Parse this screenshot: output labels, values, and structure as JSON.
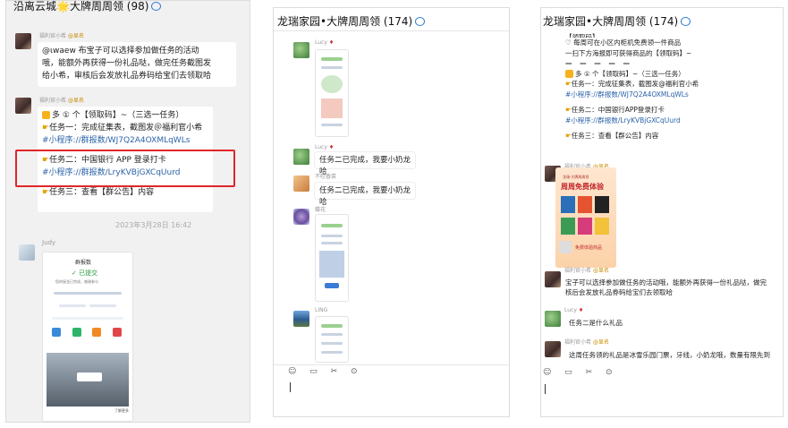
{
  "panel1": {
    "title": "沿离云城🌟大牌周周领 (98)",
    "msg1": {
      "sender": "福利官小希",
      "badge": "@显名",
      "lines": [
        "@ιwaew 布宝子可以选择参加做任务的活动",
        "哦，能额外再获得一份礼品哒，做完任务截图发",
        "给小希，审核后会发放礼品券码给宝们去领取哈"
      ]
    },
    "msg2": {
      "sender": "福利官小希",
      "badge": "@显名",
      "line1": "多 ① 个【领取码】~（三选一任务）",
      "line2": "任务一：完成征集表，截图发＠福利官小希",
      "link1": "#小程序://群报数/WJ7Q2A4OXMLqWLs",
      "line3": "任务二：中国银行 APP 登录打卡",
      "link2": "#小程序://群报数/LryKVBjGXCqUurd",
      "line4": "任务三：查看【群公告】内容"
    },
    "timestamp": "2023年3月28日 16:42",
    "judy": {
      "sender": "Judy",
      "app_name": "群报数",
      "status": "已提交",
      "desc": "您的接龙已完成，感谢参与",
      "btn_more": "了解更多"
    }
  },
  "panel2": {
    "title": "龙瑞家园•大牌周周领 (174)",
    "msgs": [
      {
        "sender": "Lucy",
        "text": ""
      },
      {
        "sender": "Lucy",
        "text": "任务二已完成，我要小奶龙哈"
      },
      {
        "sender": "不吃香菜",
        "text": "任务二已完成，我要小奶龙哈"
      },
      {
        "sender": "蝶花",
        "text": ""
      },
      {
        "sender": "LING",
        "text": ""
      }
    ],
    "toolbar": "☺ ▭ ✂ ⊙"
  },
  "panel3": {
    "title": "龙瑞家园•大牌周周领 (174)",
    "top_bubble": {
      "line0": "【领取码】",
      "line1": "♡ 每周可在小区内柜机免费领一件商品",
      "line2": "一扫下方海报即可获得商品的【领取码】~",
      "line3": "— — — — —",
      "line4": "多 ① 个【领取码】~（三选一任务）",
      "line5": "任务一：完成征集表，截图发@福利官小希",
      "link1": "#小程序://群报数/WJ7Q2A4OXMLqWLs",
      "line6": "任务二：中国银行APP登录打卡",
      "link2": "#小程序://群报数/LryKVBjGXCqUurd",
      "line7": "任务三：查看【群公告】内容"
    },
    "poster": {
      "sender": "福利官小希",
      "badge": "@显名",
      "small": "龙瑞·大牌周周领",
      "headline": "周周免费体验",
      "footer": "免费体验商品"
    },
    "msg2": {
      "sender": "福利官小希",
      "badge": "@显名",
      "line1": "宝子可以选择参加做任务的活动哦，能额外再获得一份礼品哒，做完",
      "line2": "核后会发放礼品券码给宝们去领取哈"
    },
    "msg3": {
      "sender": "Lucy",
      "text": "任务二是什么礼品"
    },
    "msg4": {
      "sender": "福利官小希",
      "badge": "@显名",
      "text": "这周任务领的礼品是冰雪乐园门票，牙线，小奶龙哦，数量有限先到"
    },
    "toolbar": "☺ ▭ ✂ ⊙"
  }
}
